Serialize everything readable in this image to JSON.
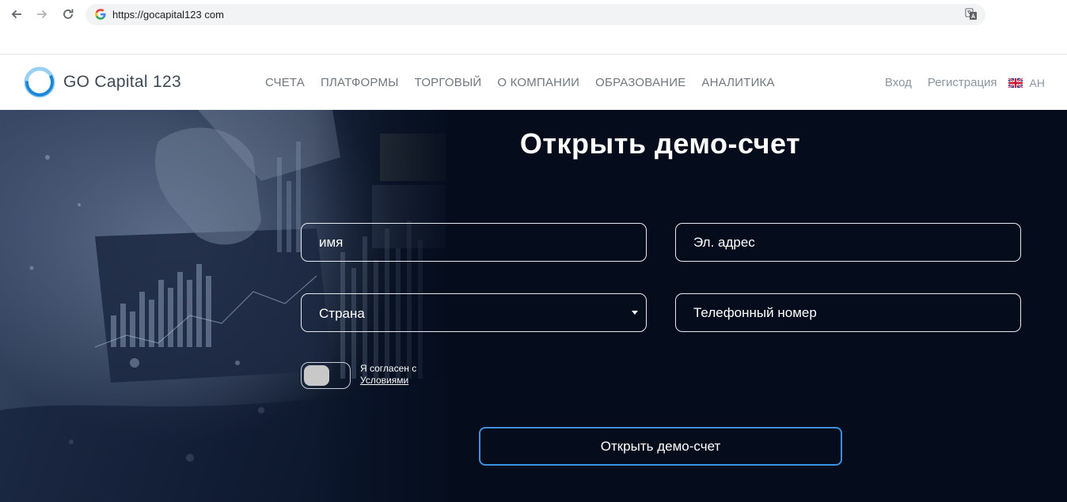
{
  "browser": {
    "url": "https://gocapital123 com",
    "back_icon": "arrow-left-icon",
    "forward_icon": "arrow-right-icon",
    "reload_icon": "reload-icon",
    "site_icon": "google-icon",
    "translate_icon": "translate-icon"
  },
  "header": {
    "logo_text": "GO Capital 123",
    "nav": [
      "СЧЕТА",
      "ПЛАТФОРМЫ",
      "ТОРГОВЫЙ",
      "О КОМПАНИИ",
      "ОБРАЗОВАНИЕ",
      "АНАЛИТИКА"
    ],
    "login": "Вход",
    "register": "Регистрация",
    "language": "АН",
    "flag_icon": "uk-flag-icon"
  },
  "form": {
    "title": "Открыть демо-счет",
    "name_placeholder": "имя",
    "email_placeholder": "Эл. адрес",
    "country_label": "Страна",
    "phone_placeholder": "Телефонный номер",
    "terms_prefix": "Я согласен с",
    "terms_link": "Условиями",
    "submit_label": "Открыть демо-счет"
  },
  "colors": {
    "hero_background": "#050d1d",
    "button_border": "#3d8fdf",
    "logo_blue": "#1e88d8"
  }
}
